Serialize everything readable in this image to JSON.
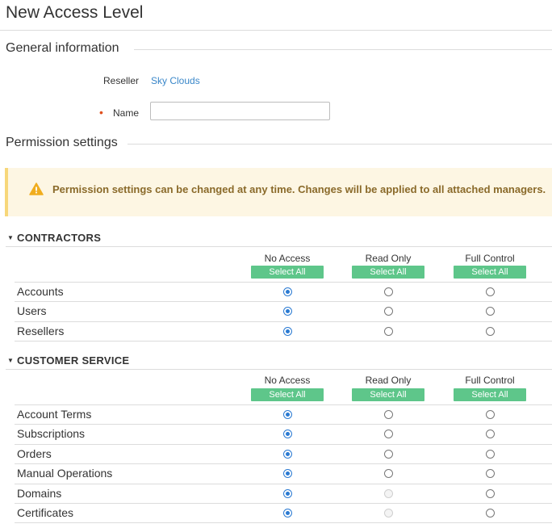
{
  "page": {
    "title": "New Access Level"
  },
  "general": {
    "title": "General information",
    "reseller_label": "Reseller",
    "reseller_value": "Sky Clouds",
    "name_label": "Name",
    "name_value": ""
  },
  "permission": {
    "title": "Permission settings",
    "alert_text": "Permission settings can be changed at any time. Changes will be applied to all attached managers."
  },
  "columns": [
    "No Access",
    "Read Only",
    "Full Control"
  ],
  "select_all_label": "Select All",
  "groups": [
    {
      "name": "CONTRACTORS",
      "rows": [
        {
          "label": "Accounts",
          "selected": 0,
          "disabled": []
        },
        {
          "label": "Users",
          "selected": 0,
          "disabled": []
        },
        {
          "label": "Resellers",
          "selected": 0,
          "disabled": []
        }
      ]
    },
    {
      "name": "CUSTOMER SERVICE",
      "rows": [
        {
          "label": "Account Terms",
          "selected": 0,
          "disabled": []
        },
        {
          "label": "Subscriptions",
          "selected": 0,
          "disabled": []
        },
        {
          "label": "Orders",
          "selected": 0,
          "disabled": []
        },
        {
          "label": "Manual Operations",
          "selected": 0,
          "disabled": []
        },
        {
          "label": "Domains",
          "selected": 0,
          "disabled": [
            1
          ]
        },
        {
          "label": "Certificates",
          "selected": 0,
          "disabled": [
            1
          ]
        }
      ]
    }
  ],
  "colors": {
    "accent": "#3a87c9",
    "select_all": "#5ec68a",
    "radio_checked": "#2a7ad2",
    "required": "#e0501e",
    "warning": "#f0ad1e"
  }
}
